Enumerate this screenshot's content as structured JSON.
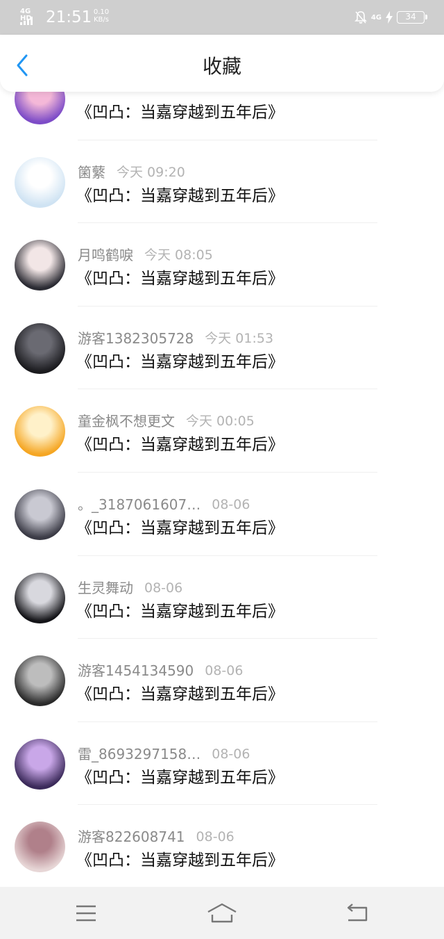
{
  "status_bar": {
    "network_tag": "4G HD",
    "time": "21:51",
    "speed_value": "0.10",
    "speed_unit": "KB/s",
    "network_right": "4G",
    "battery": "34"
  },
  "header": {
    "title": "收藏",
    "back_icon": "chevron-left-icon",
    "accent_color": "#2196f3"
  },
  "favorites": [
    {
      "name": "",
      "time": "",
      "title": "《凹凸：当嘉穿越到五年后》",
      "avatar_colors": [
        "#7d4cc7",
        "#f4b8d8"
      ]
    },
    {
      "name": "箘蘩",
      "time": "今天 09:20",
      "title": "《凹凸：当嘉穿越到五年后》",
      "avatar_colors": [
        "#cfe3f3",
        "#ffffff"
      ]
    },
    {
      "name": "月鸣鹤唳",
      "time": "今天 08:05",
      "title": "《凹凸：当嘉穿越到五年后》",
      "avatar_colors": [
        "#2b2b33",
        "#f2e6e6"
      ]
    },
    {
      "name": "游客1382305728",
      "time": "今天 01:53",
      "title": "《凹凸：当嘉穿越到五年后》",
      "avatar_colors": [
        "#1b1b1f",
        "#6a6a72"
      ]
    },
    {
      "name": "童金枫不想更文",
      "time": "今天 00:05",
      "title": "《凹凸：当嘉穿越到五年后》",
      "avatar_colors": [
        "#f5a623",
        "#fff1c9"
      ]
    },
    {
      "name": "。_3187061607…",
      "time": "08-06",
      "title": "《凹凸：当嘉穿越到五年后》",
      "avatar_colors": [
        "#3b3b46",
        "#c9c9d2"
      ]
    },
    {
      "name": "生灵舞动",
      "time": "08-06",
      "title": "《凹凸：当嘉穿越到五年后》",
      "avatar_colors": [
        "#141418",
        "#d8d8de"
      ]
    },
    {
      "name": "游客1454134590",
      "time": "08-06",
      "title": "《凹凸：当嘉穿越到五年后》",
      "avatar_colors": [
        "#2a2a2a",
        "#bdbdbd"
      ]
    },
    {
      "name": "雷_8693297158…",
      "time": "08-06",
      "title": "《凹凸：当嘉穿越到五年后》",
      "avatar_colors": [
        "#3b2a5a",
        "#c9a7e8"
      ]
    },
    {
      "name": "游客822608741",
      "time": "08-06",
      "title": "《凹凸：当嘉穿越到五年后》",
      "avatar_colors": [
        "#e7d6d6",
        "#b0808a"
      ]
    }
  ],
  "bottom_nav": {
    "menu_icon": "menu-icon",
    "home_icon": "home-icon",
    "back_icon": "return-icon"
  }
}
